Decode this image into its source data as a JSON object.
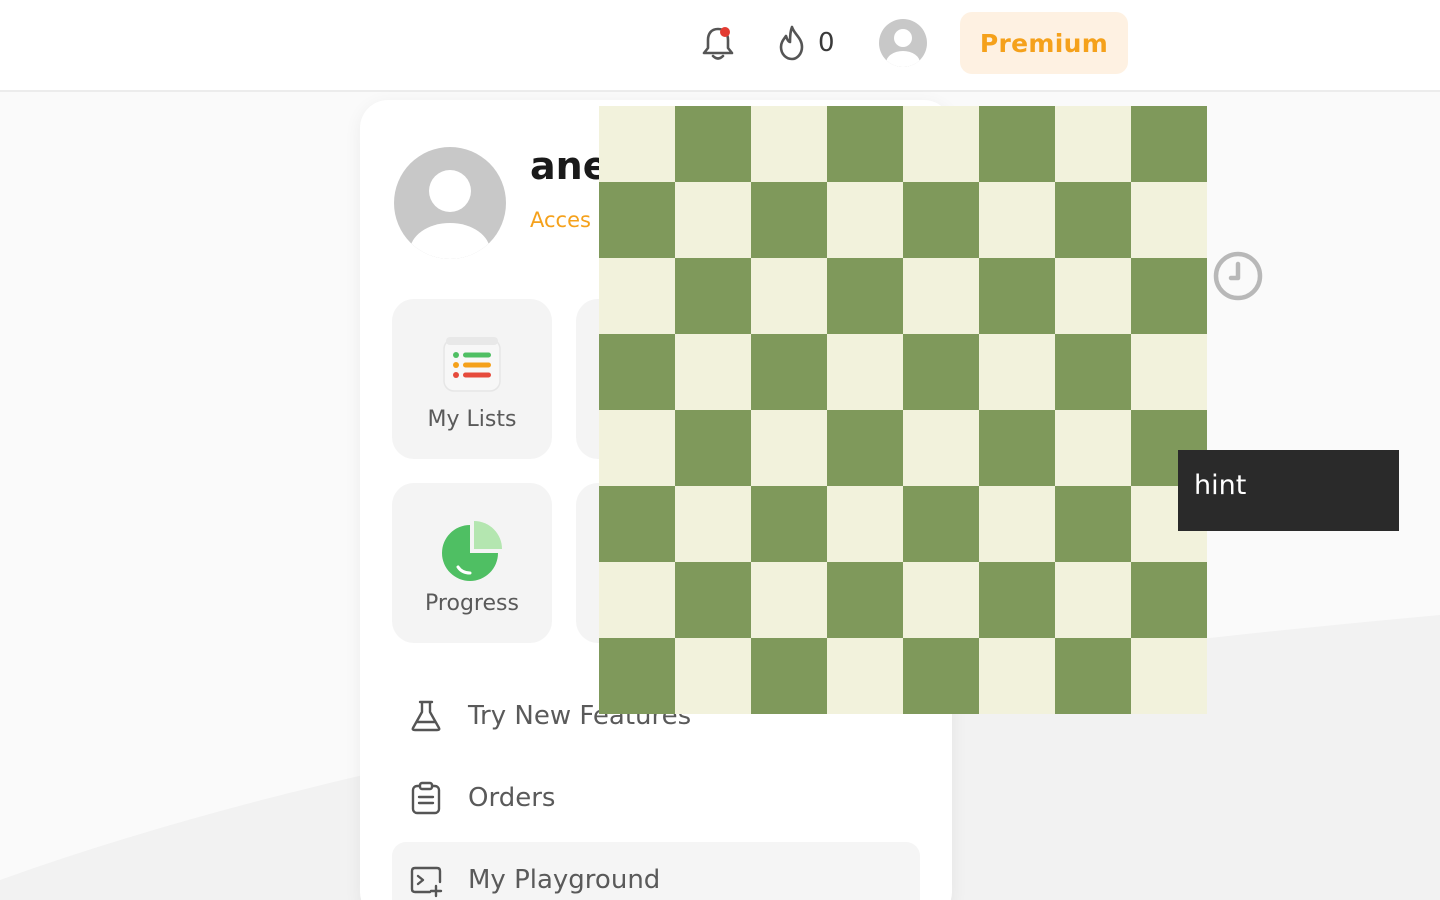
{
  "header": {
    "streak_count": "0",
    "premium_label": "Premium",
    "notification_dot_color": "#e33b32"
  },
  "profile": {
    "username": "anev",
    "premium_cta": "Acces Premiu"
  },
  "tiles": [
    {
      "label": "My Lists",
      "icon": "list-icon"
    },
    {
      "label": "Progress",
      "icon": "pie-chart-icon"
    }
  ],
  "menu": {
    "items": [
      {
        "label": "Try New Features",
        "icon": "flask-icon"
      },
      {
        "label": "Orders",
        "icon": "clipboard-icon"
      },
      {
        "label": "My Playground",
        "icon": "terminal-icon"
      }
    ]
  },
  "board": {
    "light_color": "#f2f2dc",
    "dark_color": "#7f995b",
    "size": 8
  },
  "hint": {
    "label": "hint"
  },
  "colors": {
    "accent": "#f5a11b",
    "premium_bg": "#fef1e2"
  }
}
